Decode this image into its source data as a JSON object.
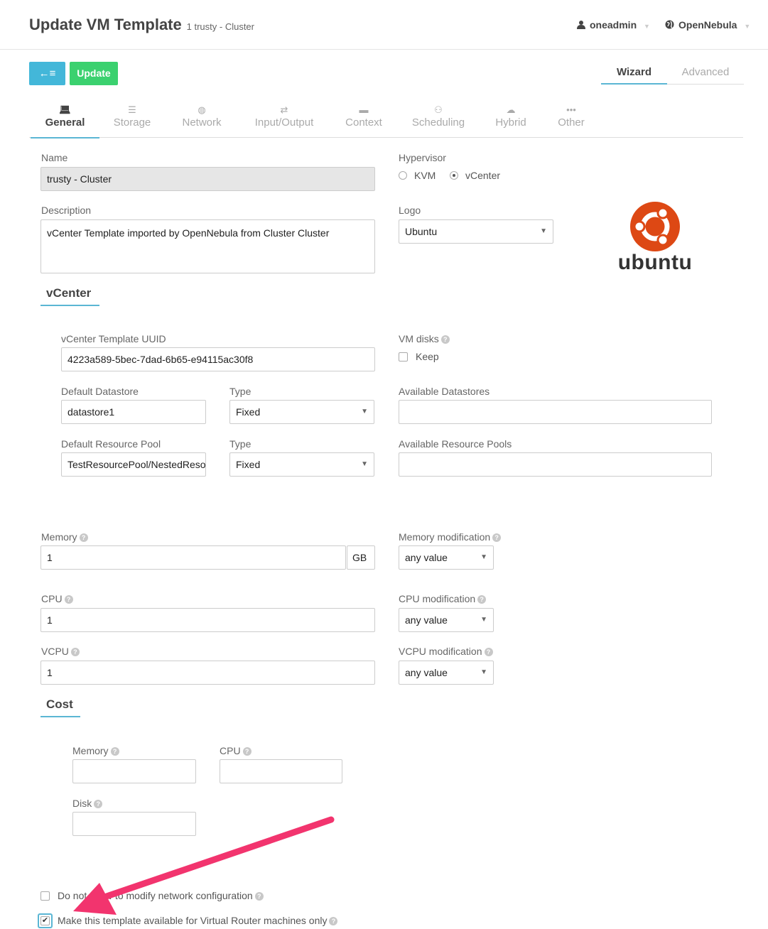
{
  "header": {
    "title": "Update VM Template",
    "subtitle": "1 trusty - Cluster",
    "user": "oneadmin",
    "zone": "OpenNebula"
  },
  "toolbar": {
    "back_label": "←≡",
    "update_label": "Update",
    "modes": [
      "Wizard",
      "Advanced"
    ]
  },
  "tabs": [
    "General",
    "Storage",
    "Network",
    "Input/Output",
    "Context",
    "Scheduling",
    "Hybrid",
    "Other"
  ],
  "general": {
    "name_label": "Name",
    "name_value": "trusty - Cluster",
    "description_label": "Description",
    "description_value": "vCenter Template imported by OpenNebula from Cluster Cluster",
    "hypervisor_label": "Hypervisor",
    "hypervisor_kvm": "KVM",
    "hypervisor_vcenter": "vCenter",
    "logo_label": "Logo",
    "logo_value": "Ubuntu",
    "logo_text": "ubuntu"
  },
  "vcenter": {
    "section_title": "vCenter",
    "uuid_label": "vCenter Template UUID",
    "uuid_value": "4223a589-5bec-7dad-6b65-e94115ac30f8",
    "vm_disks_label": "VM disks",
    "keep_label": "Keep",
    "default_datastore_label": "Default Datastore",
    "default_datastore_value": "datastore1",
    "type_label": "Type",
    "type_value": "Fixed",
    "available_datastores_label": "Available Datastores",
    "default_pool_label": "Default Resource Pool",
    "default_pool_value": "TestResourcePool/NestedResourcePool",
    "available_pools_label": "Available Resource Pools"
  },
  "capacity": {
    "memory_label": "Memory",
    "memory_value": "1",
    "memory_unit": "GB",
    "memory_mod_label": "Memory modification",
    "cpu_label": "CPU",
    "cpu_value": "1",
    "cpu_mod_label": "CPU modification",
    "vcpu_label": "VCPU",
    "vcpu_value": "1",
    "vcpu_mod_label": "VCPU modification",
    "mod_value": "any value"
  },
  "cost": {
    "section_title": "Cost",
    "memory_label": "Memory",
    "cpu_label": "CPU",
    "disk_label": "Disk"
  },
  "options": {
    "no_network_label": "Do not allow to modify network configuration",
    "vrouter_label": "Make this template available for Virtual Router machines only"
  },
  "colors": {
    "accent": "#5bb6d4",
    "update_button": "#3bd16f",
    "back_button": "#43b7d9",
    "ubuntu_orange": "#dd4814",
    "annotation_arrow": "#f2346e"
  },
  "icons": {
    "user": "user-icon",
    "zone": "globe-icon",
    "help": "question-circle-icon"
  }
}
